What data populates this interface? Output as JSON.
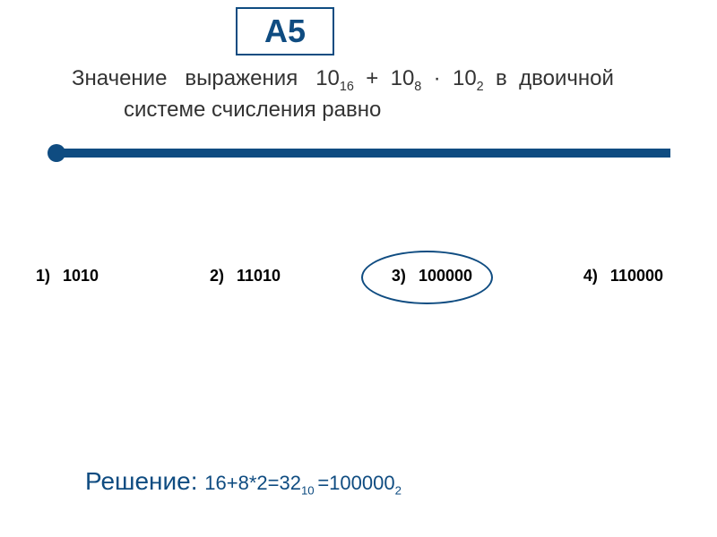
{
  "title": "A5",
  "question_line1_prefix": "Значение   выражения   10",
  "question_sub1": "16",
  "question_plus": "  +  10",
  "question_sub2": "8",
  "question_dot": "  ·  10",
  "question_sub3": "2",
  "question_line1_suffix": "  в  двоичной",
  "question_line2": "системе счисления равно",
  "options": [
    {
      "num": "1)",
      "val": "1010"
    },
    {
      "num": "2)",
      "val": "11010"
    },
    {
      "num": "3)",
      "val": "100000"
    },
    {
      "num": "4)",
      "val": "110000"
    }
  ],
  "solution_label": "Решение: ",
  "solution_prefix": "16+8*2=32",
  "solution_sub1": "10 ",
  "solution_eq": "=100000",
  "solution_sub2": "2"
}
